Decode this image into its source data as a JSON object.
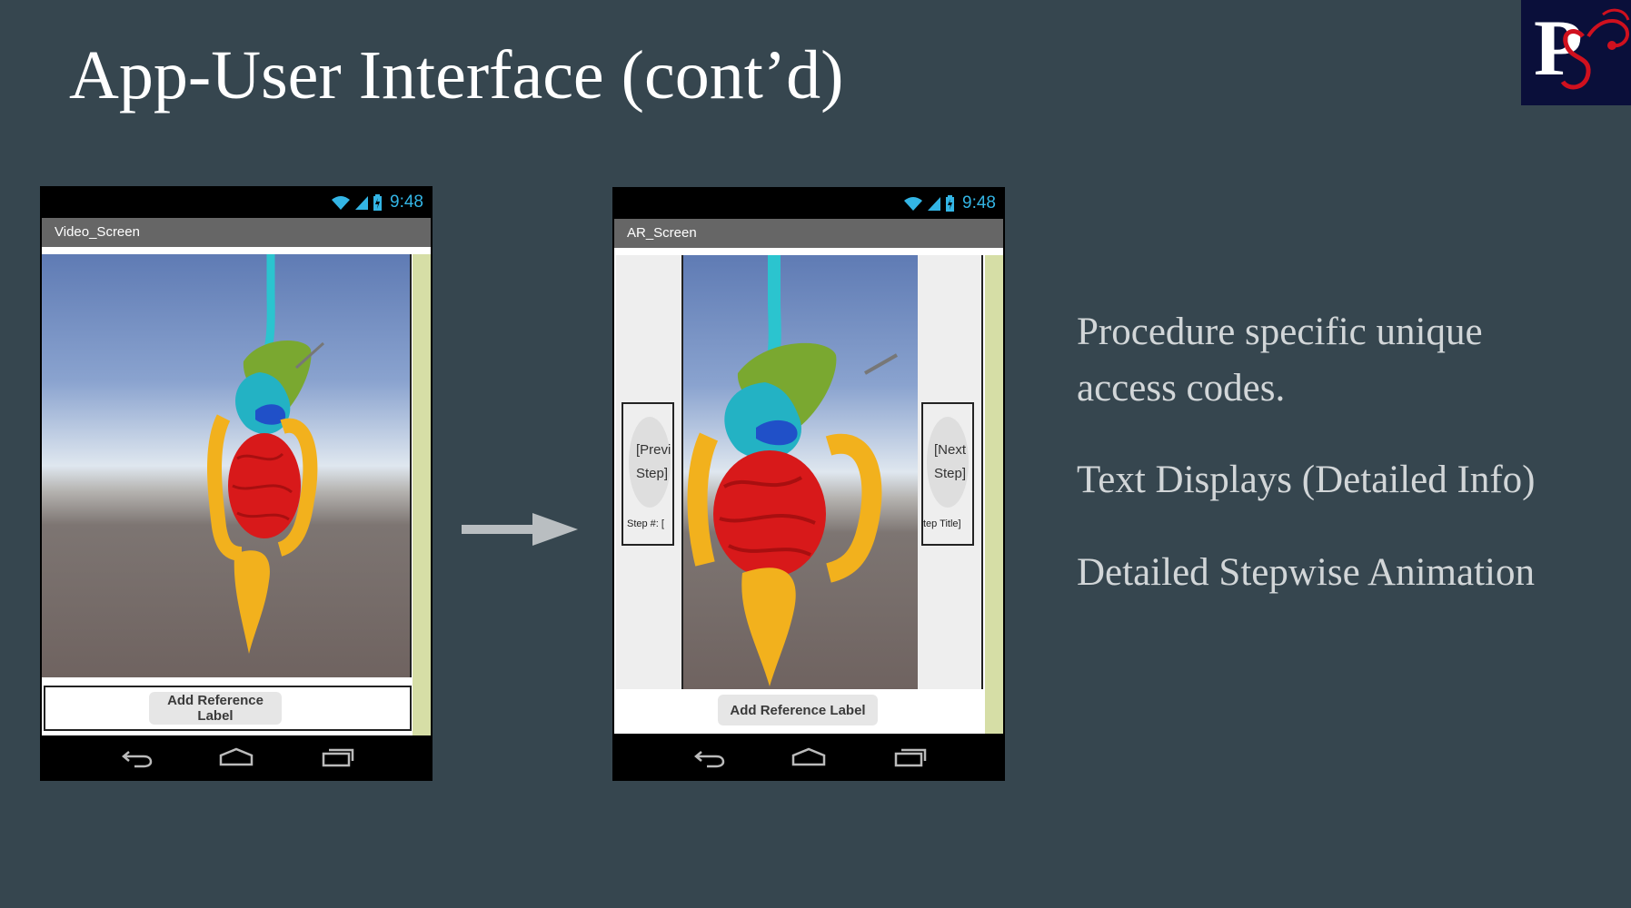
{
  "slide": {
    "title": "App-User Interface (cont’d)",
    "background_color": "#36464f",
    "logo_icon": "ps-stethoscope-logo"
  },
  "status_bar": {
    "time": "9:48",
    "icons": [
      "wifi-icon",
      "signal-icon",
      "battery-icon"
    ],
    "accent_color": "#33b5e5"
  },
  "video_screen": {
    "title": "Video_Screen",
    "button_label": "Add Reference Label",
    "image": "3d-digestive-system-render"
  },
  "ar_screen": {
    "title": "AR_Screen",
    "prev_button": "[Previ\nStep]",
    "next_button": "[Next\nStep]",
    "step_number_label": "Step #: [",
    "step_title_label": "tep Title]",
    "button_label": "Add Reference Label",
    "image": "3d-digestive-system-render"
  },
  "nav_bar": {
    "icons": [
      "back-icon",
      "home-icon",
      "recents-icon"
    ]
  },
  "arrow_icon": "right-arrow-icon",
  "bullets": [
    "Procedure specific unique",
    "access codes.",
    "Text Displays (Detailed Info)",
    "Detailed Stepwise Animation"
  ]
}
